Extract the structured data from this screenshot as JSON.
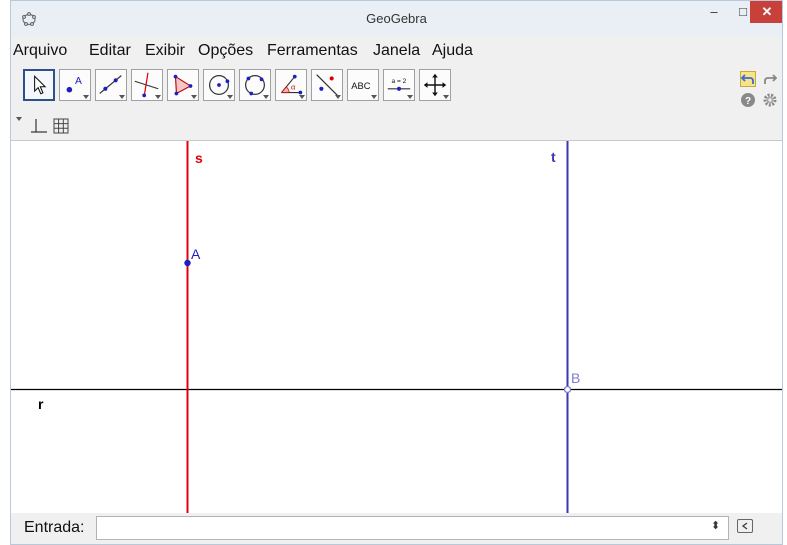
{
  "window": {
    "title": "GeoGebra",
    "minimize_glyph": "–",
    "maximize_glyph": "□",
    "close_glyph": "✕"
  },
  "menu": {
    "items": [
      "Arquivo",
      "Editar",
      "Exibir",
      "Opções",
      "Ferramentas",
      "Janela",
      "Ajuda"
    ]
  },
  "toolbar": {
    "tools": [
      {
        "icon": "move-arrow-icon",
        "selected": true
      },
      {
        "icon": "new-point-icon",
        "text": "A"
      },
      {
        "icon": "line-icon"
      },
      {
        "icon": "perpendicular-line-icon"
      },
      {
        "icon": "polygon-icon"
      },
      {
        "icon": "circle-center-point-icon"
      },
      {
        "icon": "circle-three-points-icon"
      },
      {
        "icon": "angle-icon",
        "text": "α"
      },
      {
        "icon": "reflect-line-icon"
      },
      {
        "icon": "text-icon",
        "text": "ABC"
      },
      {
        "icon": "slider-icon",
        "text": "a = 2"
      },
      {
        "icon": "move-graphics-icon"
      }
    ]
  },
  "graphics": {
    "objects": {
      "line_s": {
        "label": "s",
        "color": "#e3000f"
      },
      "line_t": {
        "label": "t",
        "color": "#3c36b4"
      },
      "line_r": {
        "label": "r",
        "color": "#000000"
      },
      "point_A": {
        "label": "A",
        "color": "#1f1fbf"
      },
      "point_B": {
        "label": "B",
        "color": "#7f7fd0"
      }
    }
  },
  "input_bar": {
    "label": "Entrada:",
    "value": "",
    "spinner": "⬍"
  }
}
